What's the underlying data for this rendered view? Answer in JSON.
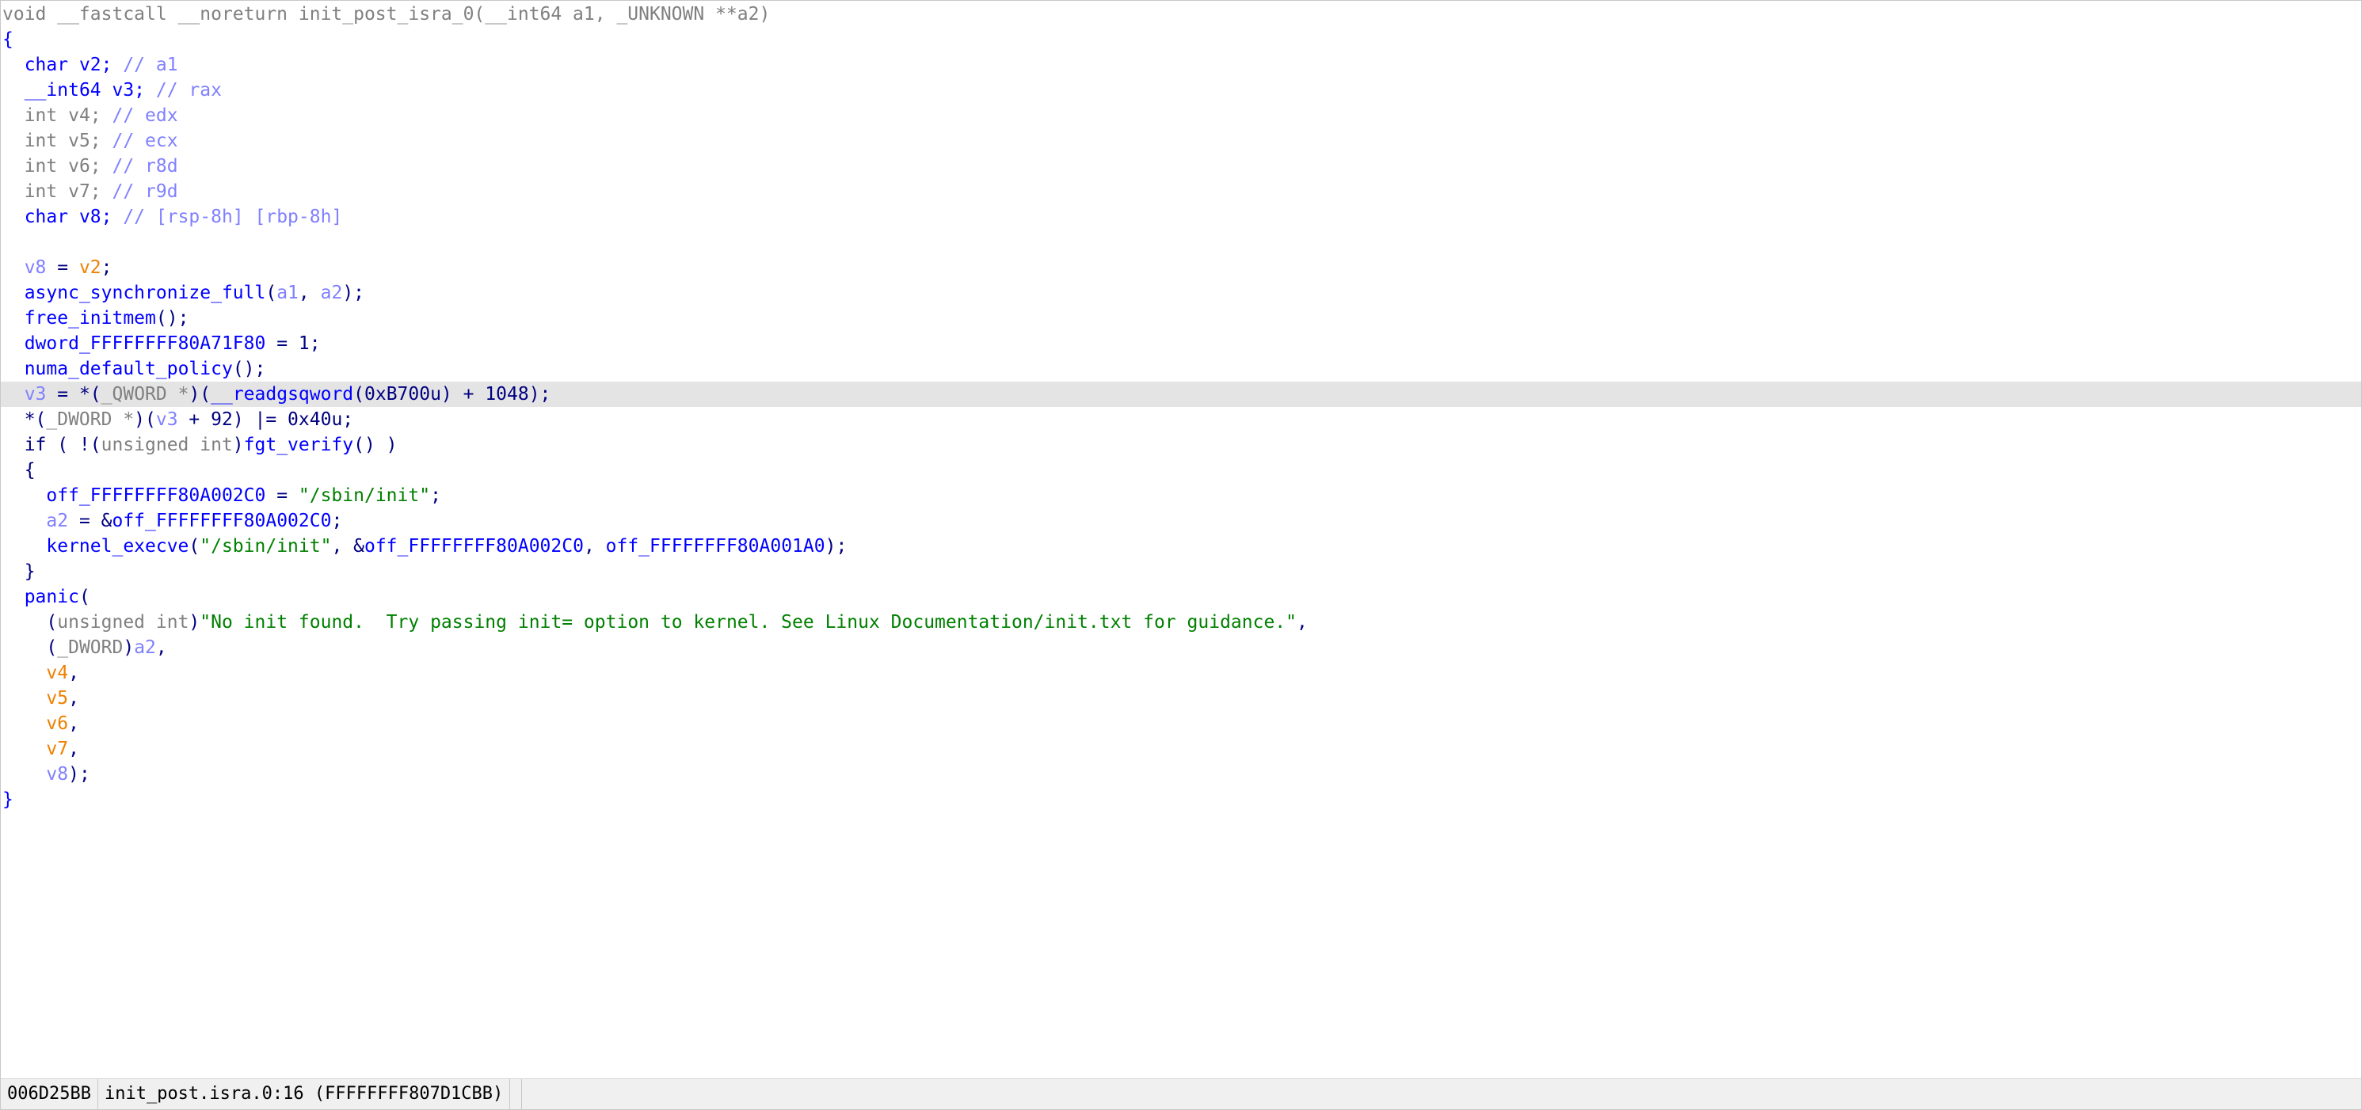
{
  "colors": {
    "background": "#ffffff",
    "highlight_line": "#e4e4e4",
    "keyword_gray": "#808080",
    "identifier_blue": "#0000ff",
    "local_var_lightblue": "#8080ff",
    "arg_orange": "#f08000",
    "string_green": "#008000",
    "punct_navy": "#000080",
    "statusbar_bg": "#f0f0f0"
  },
  "editor": {
    "highlighted_line": 15,
    "lines": [
      [
        [
          "kw",
          "void __fastcall __noreturn init_post_isra_0(__int64 a1, _UNKNOWN **a2)"
        ]
      ],
      [
        [
          "fn",
          "{"
        ]
      ],
      [
        [
          "pun",
          "  "
        ],
        [
          "fn",
          "char v2; "
        ],
        [
          "cmt",
          "// a1"
        ]
      ],
      [
        [
          "pun",
          "  "
        ],
        [
          "fn",
          "__int64 v3; "
        ],
        [
          "cmt",
          "// rax"
        ]
      ],
      [
        [
          "pun",
          "  "
        ],
        [
          "kw",
          "int v4; "
        ],
        [
          "cmt",
          "// edx"
        ]
      ],
      [
        [
          "pun",
          "  "
        ],
        [
          "kw",
          "int v5; "
        ],
        [
          "cmt",
          "// ecx"
        ]
      ],
      [
        [
          "pun",
          "  "
        ],
        [
          "kw",
          "int v6; "
        ],
        [
          "cmt",
          "// r8d"
        ]
      ],
      [
        [
          "pun",
          "  "
        ],
        [
          "kw",
          "int v7; "
        ],
        [
          "cmt",
          "// r9d"
        ]
      ],
      [
        [
          "pun",
          "  "
        ],
        [
          "fn",
          "char v8; "
        ],
        [
          "cmt",
          "// [rsp-8h] [rbp-8h]"
        ]
      ],
      [
        [
          "pun",
          ""
        ]
      ],
      [
        [
          "pun",
          "  "
        ],
        [
          "var",
          "v8"
        ],
        [
          "pun",
          " = "
        ],
        [
          "org",
          "v2"
        ],
        [
          "pun",
          ";"
        ]
      ],
      [
        [
          "pun",
          "  "
        ],
        [
          "fn",
          "async_synchronize_full"
        ],
        [
          "pun",
          "("
        ],
        [
          "var",
          "a1"
        ],
        [
          "pun",
          ", "
        ],
        [
          "var",
          "a2"
        ],
        [
          "pun",
          ");"
        ]
      ],
      [
        [
          "pun",
          "  "
        ],
        [
          "fn",
          "free_initmem"
        ],
        [
          "pun",
          "();"
        ]
      ],
      [
        [
          "pun",
          "  "
        ],
        [
          "gl",
          "dword_FFFFFFFF80A71F80"
        ],
        [
          "pun",
          " = 1;"
        ]
      ],
      [
        [
          "pun",
          "  "
        ],
        [
          "fn",
          "numa_default_policy"
        ],
        [
          "pun",
          "();"
        ]
      ],
      [
        [
          "pun",
          "  "
        ],
        [
          "var",
          "v3"
        ],
        [
          "pun",
          " = *("
        ],
        [
          "ty",
          "_QWORD *"
        ],
        [
          "pun",
          ")("
        ],
        [
          "fn",
          "__readgsqword"
        ],
        [
          "pun",
          "(0xB700u) + 1048);"
        ]
      ],
      [
        [
          "pun",
          "  *("
        ],
        [
          "ty",
          "_DWORD *"
        ],
        [
          "pun",
          ")("
        ],
        [
          "var",
          "v3"
        ],
        [
          "pun",
          " + 92) |= 0x40u;"
        ]
      ],
      [
        [
          "pun",
          "  if ( !("
        ],
        [
          "ty",
          "unsigned int"
        ],
        [
          "pun",
          ")"
        ],
        [
          "fn",
          "fgt_verify"
        ],
        [
          "pun",
          "() )"
        ]
      ],
      [
        [
          "pun",
          "  {"
        ]
      ],
      [
        [
          "pun",
          "    "
        ],
        [
          "gl",
          "off_FFFFFFFF80A002C0"
        ],
        [
          "pun",
          " = "
        ],
        [
          "str",
          "\"/sbin/init\""
        ],
        [
          "pun",
          ";"
        ]
      ],
      [
        [
          "pun",
          "    "
        ],
        [
          "var",
          "a2"
        ],
        [
          "pun",
          " = &"
        ],
        [
          "gl",
          "off_FFFFFFFF80A002C0"
        ],
        [
          "pun",
          ";"
        ]
      ],
      [
        [
          "pun",
          "    "
        ],
        [
          "fn",
          "kernel_execve"
        ],
        [
          "pun",
          "("
        ],
        [
          "str",
          "\"/sbin/init\""
        ],
        [
          "pun",
          ", &"
        ],
        [
          "gl",
          "off_FFFFFFFF80A002C0"
        ],
        [
          "pun",
          ", "
        ],
        [
          "gl",
          "off_FFFFFFFF80A001A0"
        ],
        [
          "pun",
          ");"
        ]
      ],
      [
        [
          "pun",
          "  }"
        ]
      ],
      [
        [
          "pun",
          "  "
        ],
        [
          "fn",
          "panic"
        ],
        [
          "pun",
          "("
        ]
      ],
      [
        [
          "pun",
          "    ("
        ],
        [
          "ty",
          "unsigned int"
        ],
        [
          "pun",
          ")"
        ],
        [
          "str",
          "\"No init found.  Try passing init= option to kernel. See Linux Documentation/init.txt for guidance.\""
        ],
        [
          "pun",
          ","
        ]
      ],
      [
        [
          "pun",
          "    ("
        ],
        [
          "ty",
          "_DWORD"
        ],
        [
          "pun",
          ")"
        ],
        [
          "var",
          "a2"
        ],
        [
          "pun",
          ","
        ]
      ],
      [
        [
          "pun",
          "    "
        ],
        [
          "org",
          "v4"
        ],
        [
          "pun",
          ","
        ]
      ],
      [
        [
          "pun",
          "    "
        ],
        [
          "org",
          "v5"
        ],
        [
          "pun",
          ","
        ]
      ],
      [
        [
          "pun",
          "    "
        ],
        [
          "org",
          "v6"
        ],
        [
          "pun",
          ","
        ]
      ],
      [
        [
          "pun",
          "    "
        ],
        [
          "org",
          "v7"
        ],
        [
          "pun",
          ","
        ]
      ],
      [
        [
          "pun",
          "    "
        ],
        [
          "var",
          "v8"
        ],
        [
          "pun",
          ");"
        ]
      ],
      [
        [
          "fn",
          "}"
        ]
      ]
    ]
  },
  "statusbar": {
    "address": "006D25BB",
    "location": "init_post.isra.0:16 (FFFFFFFF807D1CBB)"
  }
}
